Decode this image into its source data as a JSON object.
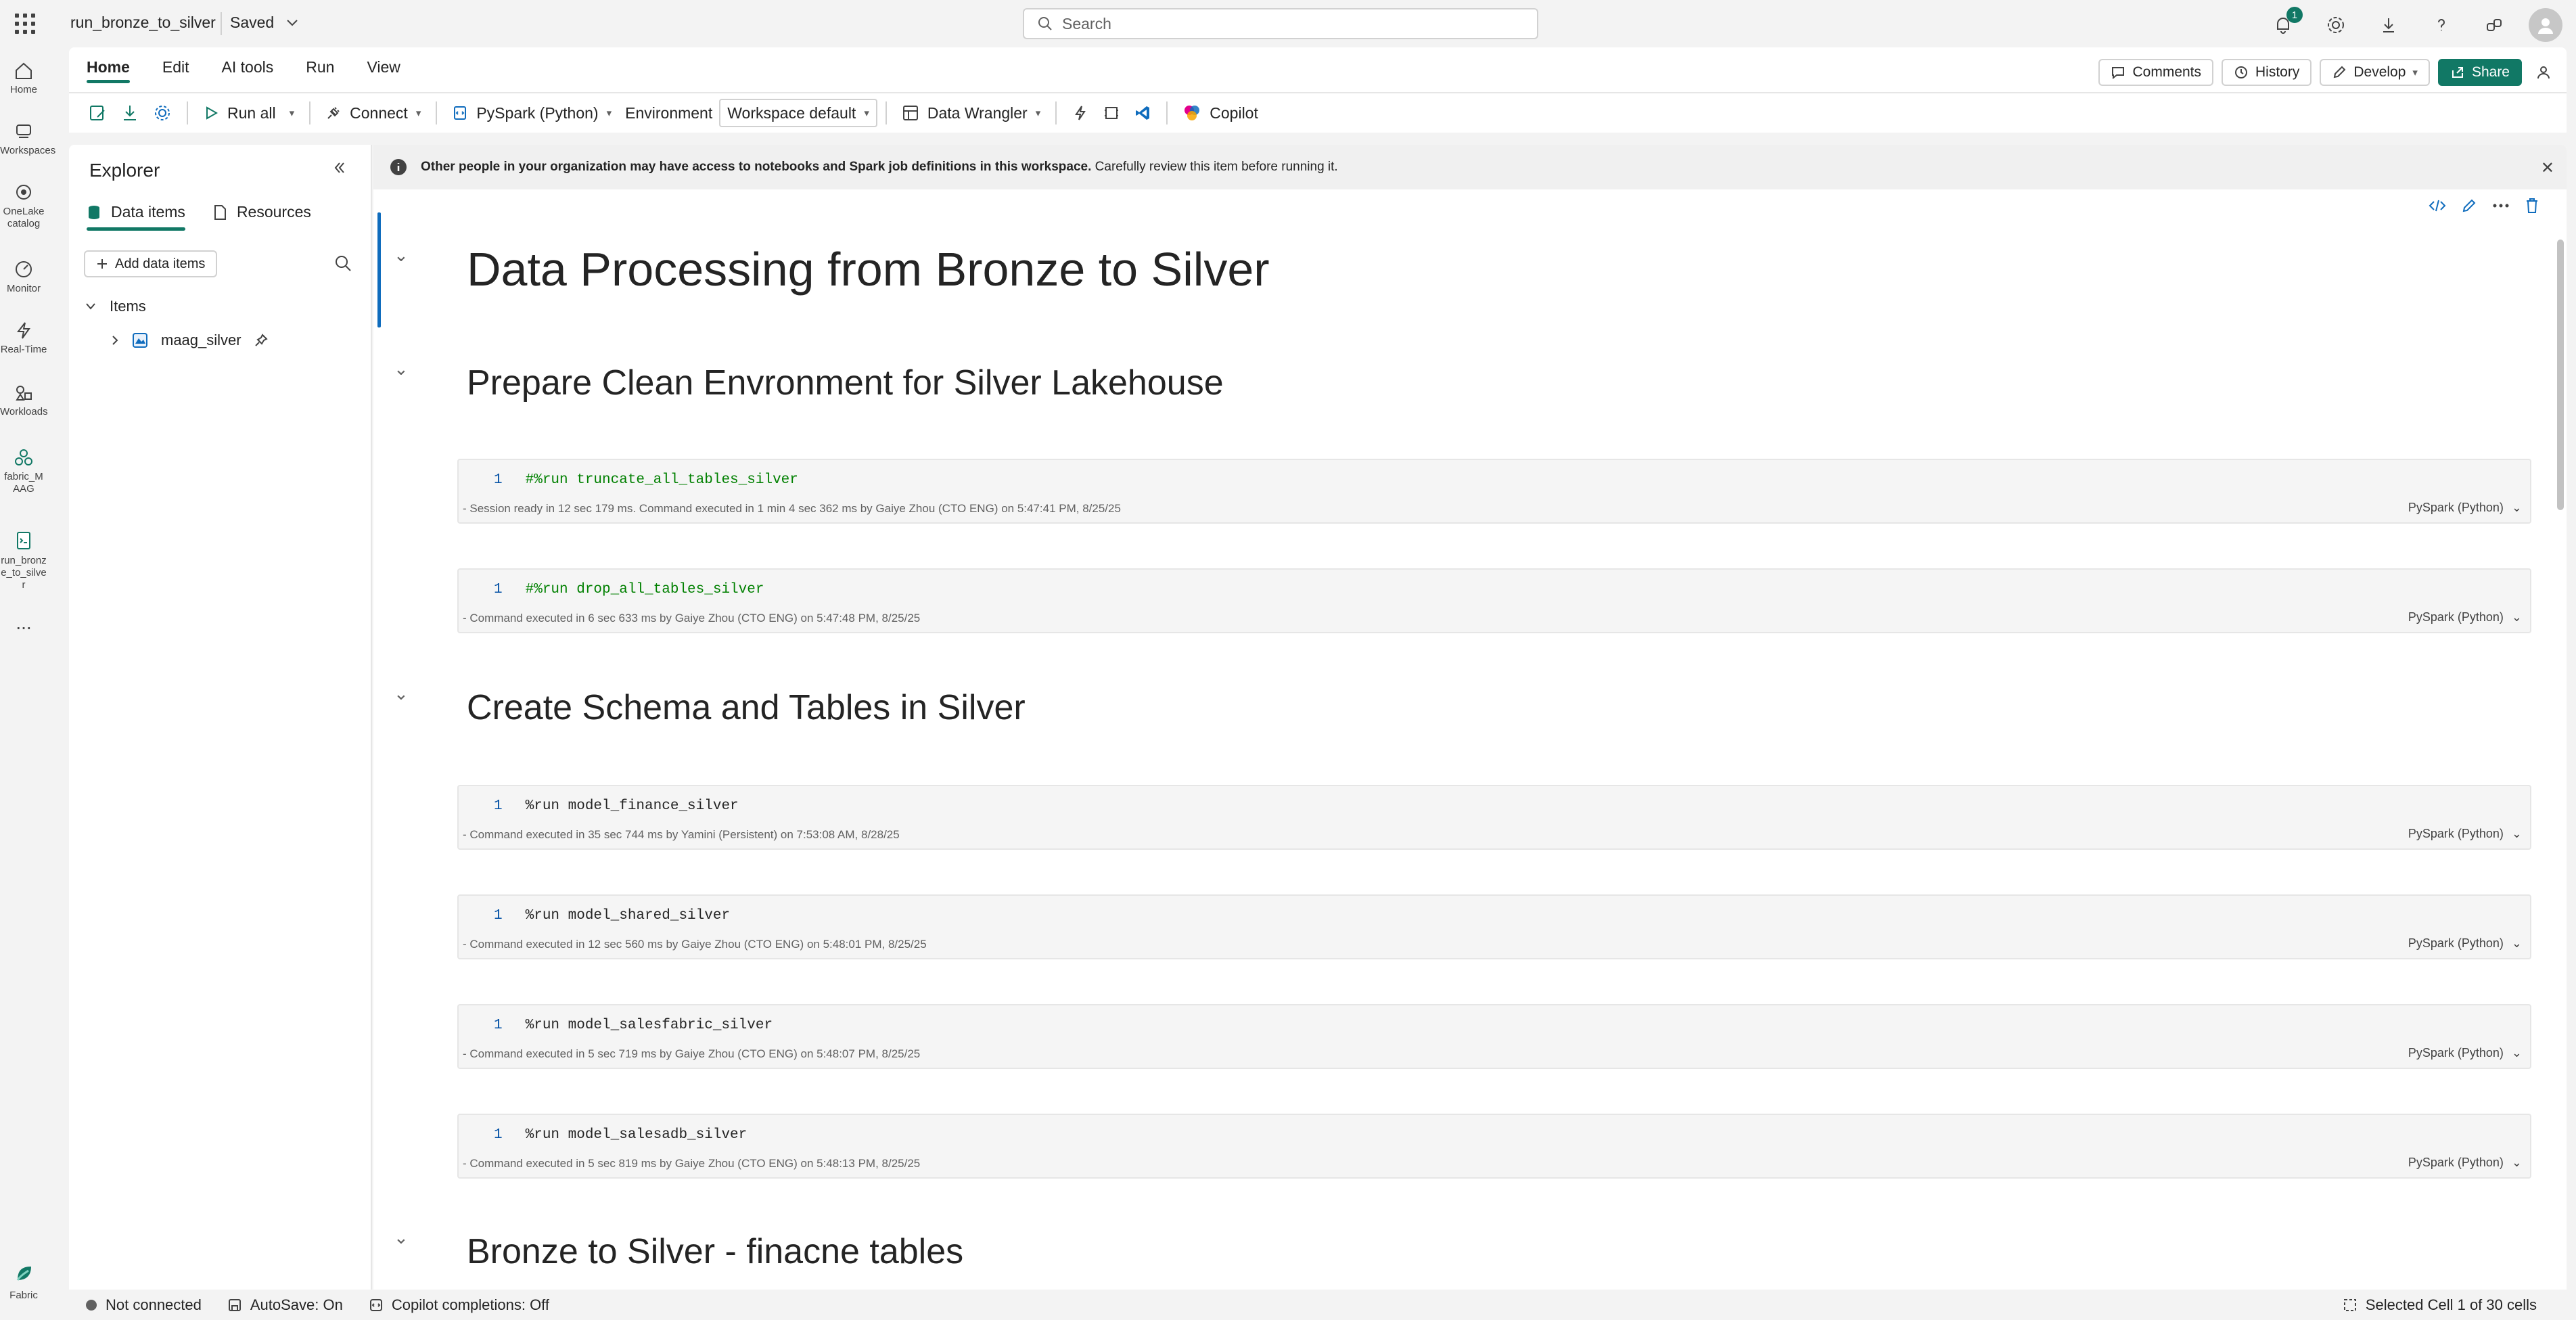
{
  "topbar": {
    "item_title": "run_bronze_to_silver",
    "saved_label": "Saved",
    "search_placeholder": "Search",
    "notification_count": "1"
  },
  "rail": {
    "items": [
      {
        "label": "Home",
        "icon": "home-icon"
      },
      {
        "label": "Workspaces",
        "icon": "workspaces-icon"
      },
      {
        "label": "OneLake catalog",
        "icon": "onelake-icon"
      },
      {
        "label": "Monitor",
        "icon": "monitor-icon"
      },
      {
        "label": "Real-Time",
        "icon": "realtime-icon"
      },
      {
        "label": "Workloads",
        "icon": "workloads-icon"
      },
      {
        "label": "fabric_MAAG",
        "icon": "workspace-icon"
      },
      {
        "label": "run_bronze_to_silver",
        "icon": "notebook-icon"
      }
    ],
    "more": "...",
    "fabric_label": "Fabric"
  },
  "ribbon": {
    "tabs": [
      "Home",
      "Edit",
      "AI tools",
      "Run",
      "View"
    ],
    "right": {
      "comments": "Comments",
      "history": "History",
      "develop": "Develop",
      "share": "Share"
    },
    "toolbar": {
      "run_all": "Run all",
      "connect": "Connect",
      "language": "PySpark (Python)",
      "environment": "Environment",
      "workspace_default": "Workspace default",
      "data_wrangler": "Data Wrangler",
      "copilot": "Copilot"
    }
  },
  "explorer": {
    "title": "Explorer",
    "tabs": [
      "Data items",
      "Resources"
    ],
    "add_button": "Add data items",
    "section": "Items",
    "tree": [
      {
        "label": "maag_silver"
      }
    ]
  },
  "banner": {
    "bold": "Other people in your organization may have access to notebooks and Spark job definitions in this workspace.",
    "normal": " Carefully review this item before running it."
  },
  "notebook": {
    "headings": {
      "h1": "Data Processing from Bronze to Silver",
      "h2a": "Prepare Clean Envronment for Silver Lakehouse",
      "h2b": "Create Schema and Tables in Silver",
      "h2c": "Bronze to Silver - finacne tables"
    },
    "cells": [
      {
        "line": "1",
        "code": "#%run truncate_all_tables_silver",
        "status": "- Session ready in 12 sec 179 ms. Command executed in 1 min 4 sec 362 ms by Gaiye Zhou (CTO ENG) on 5:47:41 PM, 8/25/25",
        "lang": "PySpark (Python)"
      },
      {
        "line": "1",
        "code": "#%run drop_all_tables_silver",
        "status": "- Command executed in 6 sec 633 ms by Gaiye Zhou (CTO ENG) on 5:47:48 PM, 8/25/25",
        "lang": "PySpark (Python)"
      },
      {
        "line": "1",
        "code": "%run model_finance_silver",
        "status": "- Command executed in 35 sec 744 ms by Yamini (Persistent) on 7:53:08 AM, 8/28/25",
        "lang": "PySpark (Python)"
      },
      {
        "line": "1",
        "code": "%run model_shared_silver",
        "status": "- Command executed in 12 sec 560 ms by Gaiye Zhou (CTO ENG) on 5:48:01 PM, 8/25/25",
        "lang": "PySpark (Python)"
      },
      {
        "line": "1",
        "code": "%run model_salesfabric_silver",
        "status": "- Command executed in 5 sec 719 ms by Gaiye Zhou (CTO ENG) on 5:48:07 PM, 8/25/25",
        "lang": "PySpark (Python)"
      },
      {
        "line": "1",
        "code": "%run model_salesadb_silver",
        "status": "- Command executed in 5 sec 819 ms by Gaiye Zhou (CTO ENG) on 5:48:13 PM, 8/25/25",
        "lang": "PySpark (Python)"
      }
    ]
  },
  "statusbar": {
    "connection": "Not connected",
    "autosave": "AutoSave: On",
    "copilot": "Copilot completions: Off",
    "selection": "Selected Cell 1 of 30 cells"
  },
  "colors": {
    "accent": "#117865",
    "active_cell": "#0f6cbd"
  }
}
